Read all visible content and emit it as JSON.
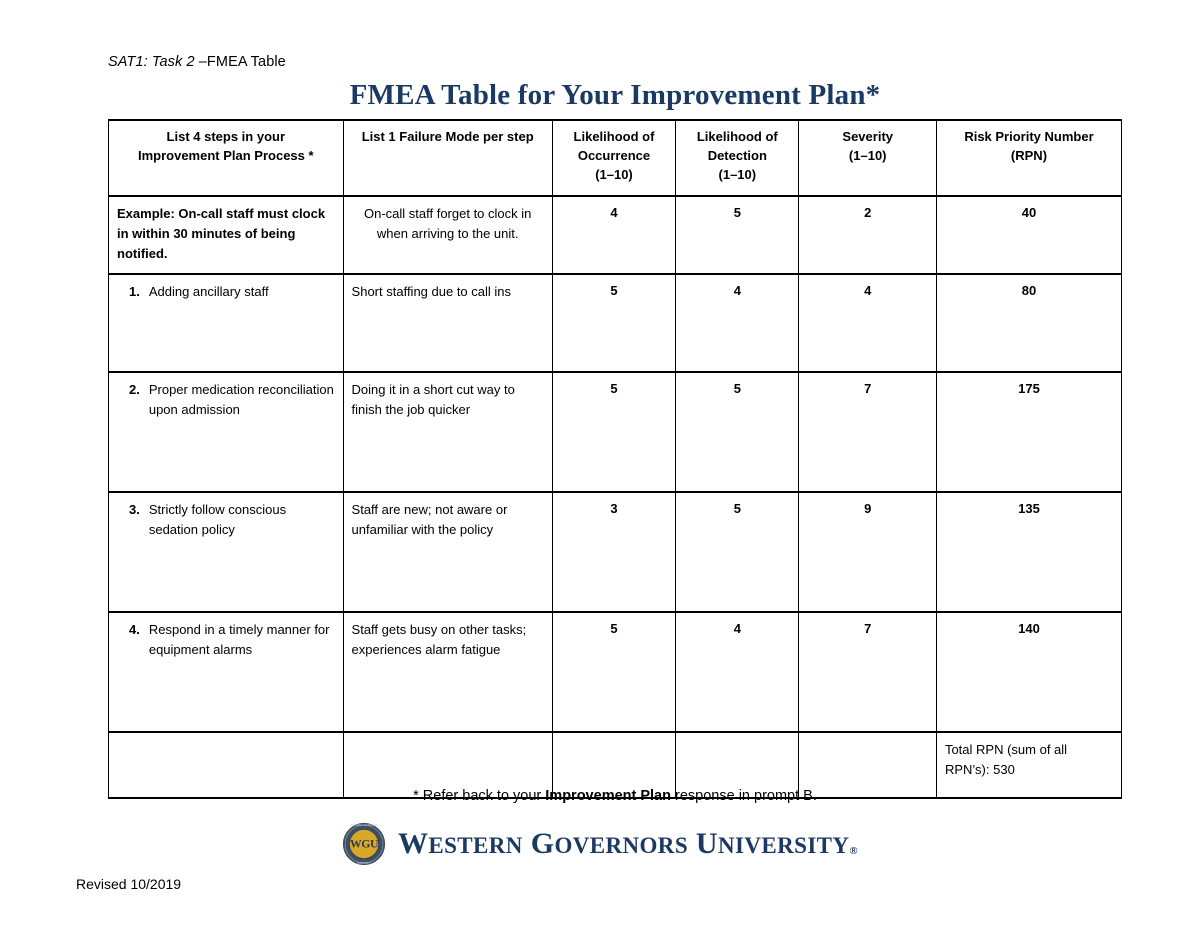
{
  "document": {
    "running_head_italic": "SAT1: Task 2 ",
    "running_head_rest": "–FMEA Table",
    "title": "FMEA Table for Your Improvement Plan*",
    "footnote_prefix": "* Refer back to your ",
    "footnote_bold": "Improvement Plan",
    "footnote_suffix": " response in prompt B.",
    "revised": "Revised 10/2019",
    "title_color": "#1b3a63"
  },
  "logo": {
    "seal_name": "wgu-seal",
    "seal_ring_color": "#3d4f63",
    "seal_disc_color": "#d8a828",
    "seal_monogram": "WGU",
    "wordmark": "WESTERN GOVERNORS UNIVERSITY",
    "wordmark_parts": [
      {
        "cap": "W",
        "rest": "ESTERN"
      },
      {
        "cap": "G",
        "rest": "OVERNORS"
      },
      {
        "cap": "U",
        "rest": "NIVERSITY"
      }
    ],
    "registered_mark": "®",
    "wordmark_color": "#1b3a63"
  },
  "table": {
    "headers": [
      "List 4 steps in your\nImprovement Plan Process *",
      "List 1 Failure Mode per step",
      "Likelihood of\nOccurrence\n(1–10)",
      "Likelihood of\nDetection\n(1–10)",
      "Severity\n(1–10)",
      "Risk Priority Number\n(RPN)"
    ],
    "headers_flat": {
      "steps": "List 4 steps in your Improvement Plan Process *",
      "steps_line1": "List 4 steps in your",
      "steps_line2": "Improvement Plan Process *",
      "failure": "List 1 Failure Mode per step",
      "occurrence_line1": "Likelihood of",
      "occurrence_line2": "Occurrence",
      "occurrence_line3": "(1–10)",
      "detection_line1": "Likelihood of",
      "detection_line2": "Detection",
      "detection_line3": "(1–10)",
      "severity_line1": "Severity",
      "severity_line2": "(1–10)",
      "rpn_line1": "Risk Priority Number",
      "rpn_line2": "(RPN)"
    },
    "example_row": {
      "label": "Example:",
      "step": "  On-call staff must clock in within 30 minutes of being notified.",
      "step_full": "Example:  On-call staff must clock in within 30 minutes of being notified.",
      "failure_mode": "On-call staff forget to clock in when arriving to the unit.",
      "occurrence": "4",
      "detection": "5",
      "severity": "2",
      "rpn": "40"
    },
    "rows": [
      {
        "number": "1.",
        "step": "Adding ancillary staff",
        "failure_mode": "Short staffing due to call ins",
        "occurrence": "5",
        "detection": "4",
        "severity": "4",
        "rpn": "80"
      },
      {
        "number": "2.",
        "step": "Proper medication reconciliation upon admission",
        "failure_mode": "Doing it in a short cut way to finish the job quicker",
        "occurrence": "5",
        "detection": "5",
        "severity": "7",
        "rpn": "175"
      },
      {
        "number": "3.",
        "step": "Strictly follow conscious sedation policy",
        "failure_mode": "Staff are new; not aware or unfamiliar with the policy",
        "occurrence": "3",
        "detection": "5",
        "severity": "9",
        "rpn": "135"
      },
      {
        "number": "4.",
        "step": "Respond in a timely manner for equipment alarms",
        "failure_mode": "Staff gets busy on other tasks; experiences alarm fatigue",
        "occurrence": "5",
        "detection": "4",
        "severity": "7",
        "rpn": "140"
      }
    ],
    "total_row": {
      "label_line1": "Total RPN (sum of all",
      "label_line2": "RPN’s):  530",
      "total_value": "530",
      "label_full": "Total RPN (sum of all RPN’s):  530"
    }
  }
}
